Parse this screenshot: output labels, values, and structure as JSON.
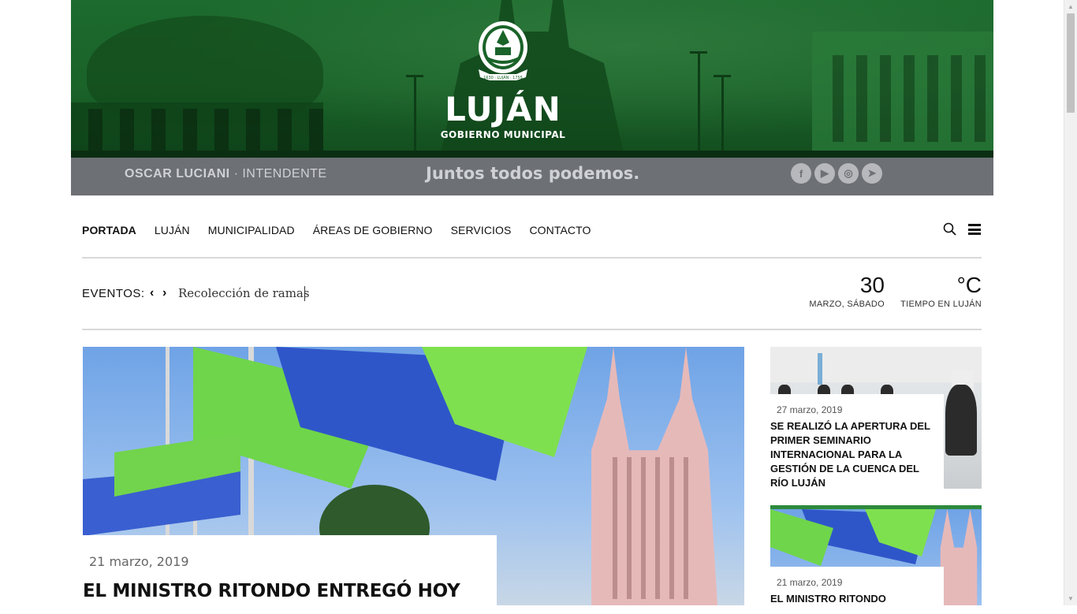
{
  "header": {
    "brand_name": "LUJÁN",
    "brand_sub": "GOBIERNO MUNICIPAL",
    "crest_motto": "1630 · LUJÁN · 1755",
    "mayor_name": "OSCAR LUCIANI",
    "mayor_separator": "·",
    "mayor_role": "INTENDENTE",
    "slogan": "Juntos todos podemos.",
    "social": [
      {
        "name": "facebook-icon",
        "glyph": "f"
      },
      {
        "name": "youtube-icon",
        "glyph": "▶"
      },
      {
        "name": "instagram-icon",
        "glyph": "◎"
      },
      {
        "name": "telegram-icon",
        "glyph": "➤"
      }
    ],
    "colors": {
      "banner": "#1a6329",
      "strip": "#6d7075",
      "strip_text": "#cfd1d4"
    }
  },
  "nav": {
    "items": [
      {
        "label": "PORTADA",
        "active": true
      },
      {
        "label": "LUJÁN",
        "active": false
      },
      {
        "label": "MUNICIPALIDAD",
        "active": false
      },
      {
        "label": "ÁREAS DE GOBIERNO",
        "active": false
      },
      {
        "label": "SERVICIOS",
        "active": false
      },
      {
        "label": "CONTACTO",
        "active": false
      }
    ],
    "search_icon": "search-icon",
    "menu_icon": "hamburger-menu-icon"
  },
  "events": {
    "label": "EVENTOS:",
    "prev_glyph": "‹",
    "next_glyph": "›",
    "current": "Recolección de ramas"
  },
  "date_widget": {
    "day": "30",
    "label": "MARZO, SÁBADO"
  },
  "weather_widget": {
    "value": "°C",
    "label": "TIEMPO EN LUJÁN"
  },
  "main_story": {
    "date": "21 marzo, 2019",
    "title": "EL MINISTRO RITONDO ENTREGÓ HOY"
  },
  "side_stories": [
    {
      "date": "27 marzo, 2019",
      "title": "SE REALIZÓ LA APERTURA DEL PRIMER SEMINARIO INTERNACIONAL PARA LA GESTIÓN DE LA CUENCA DEL RÍO LUJÁN"
    },
    {
      "date": "21 marzo, 2019",
      "title": "EL MINISTRO RITONDO"
    }
  ]
}
